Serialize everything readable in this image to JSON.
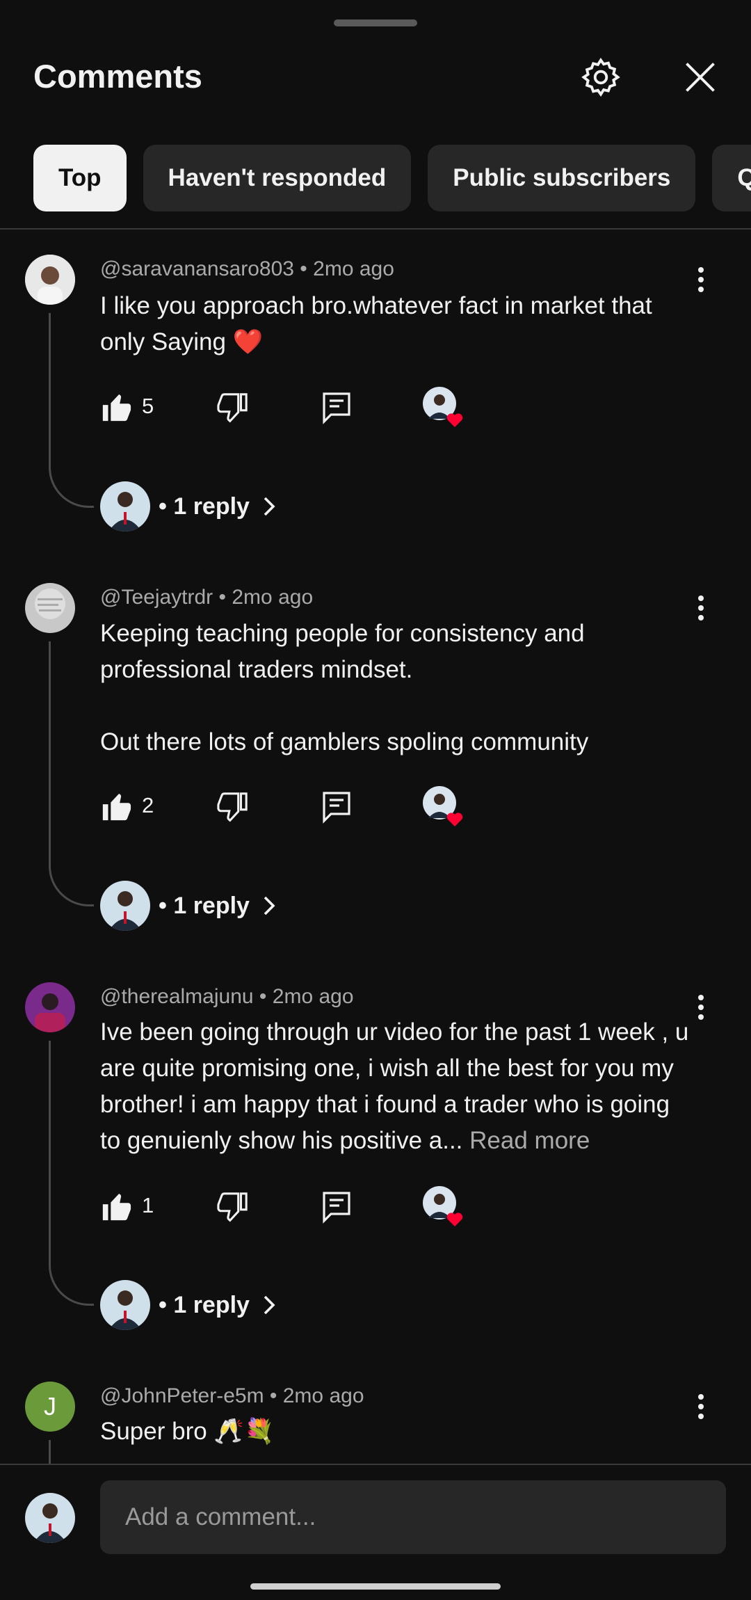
{
  "header": {
    "title": "Comments"
  },
  "filters": [
    {
      "label": "Top",
      "active": true
    },
    {
      "label": "Haven't responded",
      "active": false
    },
    {
      "label": "Public subscribers",
      "active": false
    },
    {
      "label": "Que",
      "active": false
    }
  ],
  "comments": [
    {
      "author": "@saravanansaro803",
      "age": "2mo ago",
      "text": "I like you approach bro.whatever fact in market that only Saying ❤️",
      "likes": "5",
      "replies": "• 1 reply"
    },
    {
      "author": "@Teejaytrdr",
      "age": "2mo ago",
      "text": "Keeping teaching people for consistency and professional traders mindset.\n\nOut there lots of gamblers spoling community",
      "likes": "2",
      "replies": "• 1 reply"
    },
    {
      "author": "@therealmajunu",
      "age": "2mo ago",
      "text": "Ive been going through ur video for the past 1 week , u are quite promising one, i wish all the best for you my brother! i am happy that i found a trader who is going to genuienly show his positive a...",
      "read_more": " Read more",
      "likes": "1",
      "replies": "• 1 reply"
    },
    {
      "author": "@JohnPeter-e5m",
      "age": "2mo ago",
      "text": "Super bro 🥂💐",
      "avatar_letter": "J"
    }
  ],
  "composer": {
    "placeholder": "Add a comment..."
  },
  "colors": {
    "background": "#0f0f0f",
    "chip": "#272727",
    "heart": "#ff0033",
    "avatar_j": "#6a9a3a"
  }
}
